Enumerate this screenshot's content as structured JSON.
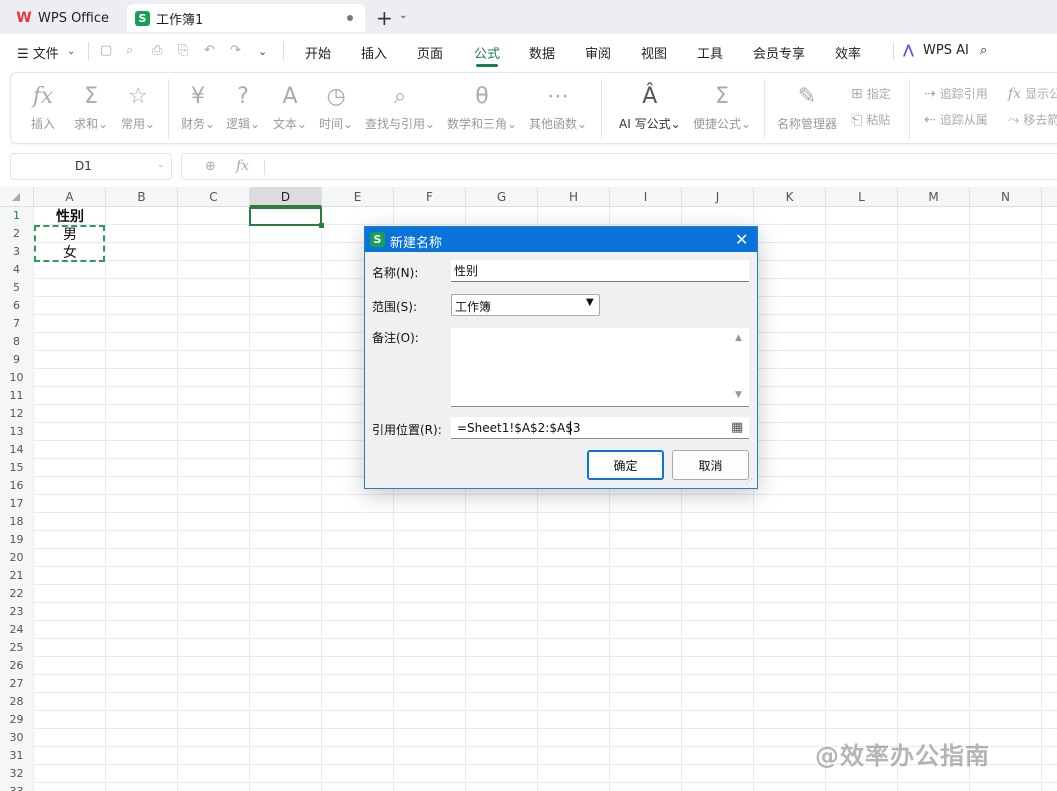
{
  "tabs": {
    "wps": "WPS Office",
    "book": "工作簿1"
  },
  "menu": {
    "file": "☰ 文件",
    "items": [
      "开始",
      "插入",
      "页面",
      "公式",
      "数据",
      "审阅",
      "视图",
      "工具",
      "会员专享",
      "效率"
    ],
    "active": "公式",
    "wps_ai": "WPS AI"
  },
  "ribbon": {
    "insert": "插入",
    "sum": "求和",
    "common": "常用",
    "finance": "财务",
    "logic": "逻辑",
    "text": "文本",
    "time": "时间",
    "lookup": "查找与引用",
    "math": "数学和三角",
    "other": "其他函数",
    "ai_formula": "AI 写公式",
    "quick_formula": "便捷公式",
    "name_manager": "名称管理器",
    "specify": "指定",
    "paste": "粘贴",
    "trace_precedents": "追踪引用",
    "trace_dependents": "追踪从属",
    "show_formula": "显示公",
    "remove_arrows": "移去箭"
  },
  "formula_bar": {
    "cell_ref": "D1",
    "fx": "fx"
  },
  "columns": [
    "A",
    "B",
    "C",
    "D",
    "E",
    "F",
    "G",
    "H",
    "I",
    "J",
    "K",
    "L",
    "M",
    "N"
  ],
  "active_column": "D",
  "rows": [
    "1",
    "2",
    "3",
    "4",
    "5",
    "6",
    "7",
    "8",
    "9",
    "10",
    "11",
    "12",
    "13",
    "14",
    "15",
    "16",
    "17",
    "18",
    "19",
    "20",
    "21",
    "22",
    "23",
    "24",
    "25",
    "26",
    "27",
    "28",
    "29",
    "30",
    "31",
    "32",
    "33"
  ],
  "cells": {
    "A1": "性别",
    "A2": "男",
    "A3": "女"
  },
  "dialog": {
    "title": "新建名称",
    "name_label": "名称(N):",
    "name_value": "性别",
    "scope_label": "范围(S):",
    "scope_value": "工作簿",
    "comment_label": "备注(O):",
    "ref_label": "引用位置(R):",
    "ref_value": "=Sheet1!$A$2:$A$3",
    "ok": "确定",
    "cancel": "取消"
  },
  "watermark": "@效率办公指南"
}
